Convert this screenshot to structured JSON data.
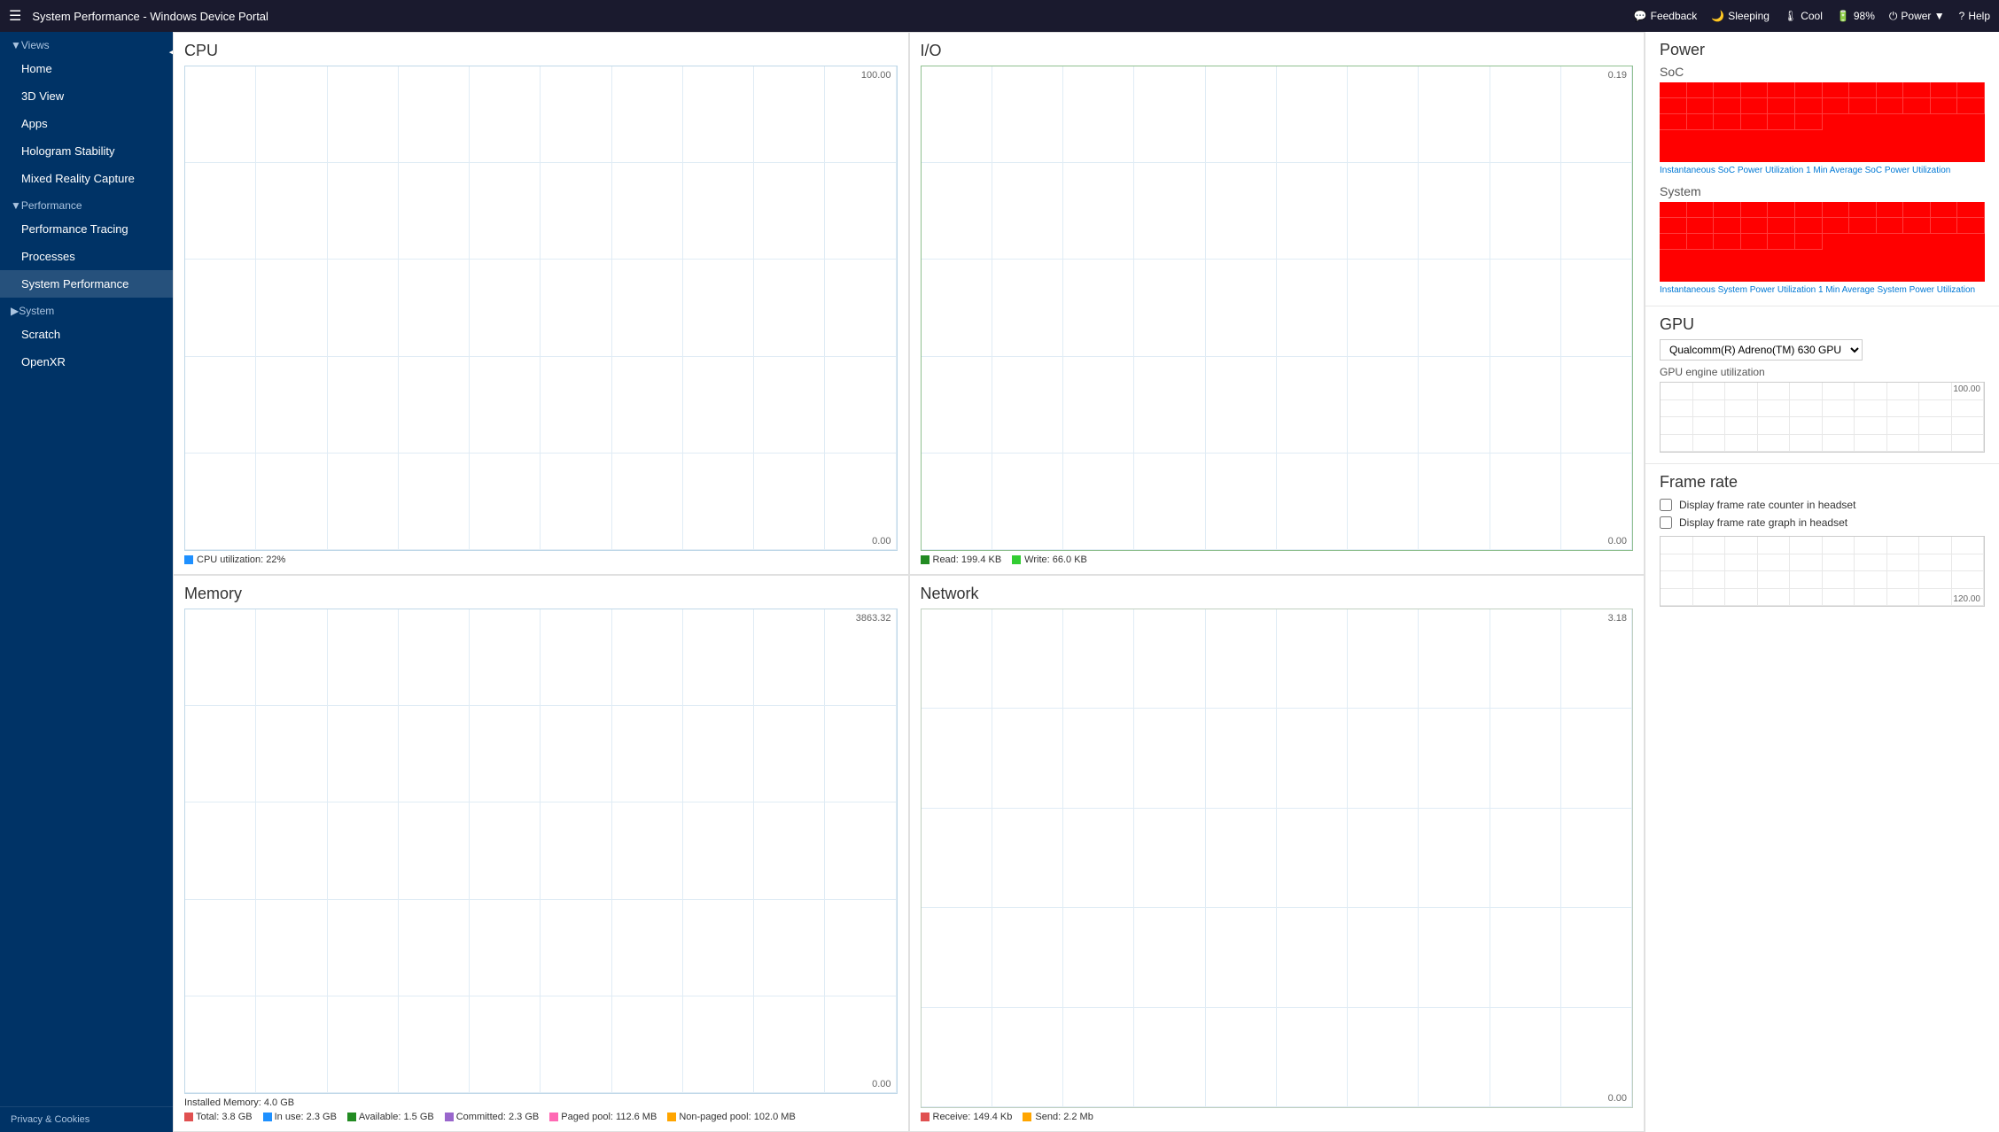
{
  "titleBar": {
    "menuIcon": "☰",
    "title": "System Performance - Windows Device Portal",
    "toolbar": [
      {
        "id": "feedback",
        "icon": "💬",
        "label": "Feedback"
      },
      {
        "id": "sleeping",
        "icon": "🌙",
        "label": "Sleeping"
      },
      {
        "id": "cool",
        "icon": "🌡",
        "label": "Cool"
      },
      {
        "id": "battery",
        "icon": "🔋",
        "label": "98%"
      },
      {
        "id": "power",
        "icon": "⏻",
        "label": "Power ▼"
      },
      {
        "id": "help",
        "icon": "?",
        "label": "Help"
      }
    ]
  },
  "sidebar": {
    "toggleIcon": "◀",
    "sections": [
      {
        "id": "views",
        "header": "▼Views",
        "items": [
          {
            "id": "home",
            "label": "Home"
          },
          {
            "id": "3dview",
            "label": "3D View"
          },
          {
            "id": "apps",
            "label": "Apps"
          },
          {
            "id": "hologram-stability",
            "label": "Hologram Stability"
          },
          {
            "id": "mixed-reality-capture",
            "label": "Mixed Reality Capture"
          }
        ]
      },
      {
        "id": "performance",
        "header": "▼Performance",
        "items": [
          {
            "id": "performance-tracing",
            "label": "Performance Tracing"
          },
          {
            "id": "processes",
            "label": "Processes"
          },
          {
            "id": "system-performance",
            "label": "System Performance",
            "active": true
          }
        ]
      },
      {
        "id": "system",
        "header": "▶System",
        "items": [
          {
            "id": "scratch",
            "label": "Scratch"
          },
          {
            "id": "openxr",
            "label": "OpenXR"
          }
        ]
      }
    ],
    "footer": "Privacy & Cookies"
  },
  "cpu": {
    "title": "CPU",
    "topValue": "100.00",
    "bottomValue": "0.00",
    "legend": [
      {
        "color": "#1e90ff",
        "label": "CPU utilization: 22%"
      }
    ]
  },
  "io": {
    "title": "I/O",
    "topValue": "0.19",
    "bottomValue": "0.00",
    "legend": [
      {
        "color": "#228B22",
        "label": "Read: 199.4 KB"
      },
      {
        "color": "#32CD32",
        "label": "Write: 66.0 KB"
      }
    ]
  },
  "memory": {
    "title": "Memory",
    "topValue": "3863.32",
    "bottomValue": "0.00",
    "installed": "Installed Memory: 4.0 GB",
    "legend": [
      {
        "color": "#e05050",
        "label": "Total: 3.8 GB"
      },
      {
        "color": "#1e90ff",
        "label": "In use: 2.3 GB"
      },
      {
        "color": "#228B22",
        "label": "Available: 1.5 GB"
      },
      {
        "color": "#9966cc",
        "label": "Committed: 2.3 GB"
      },
      {
        "color": "#ff69b4",
        "label": "Paged pool: 112.6 MB"
      },
      {
        "color": "#ffa500",
        "label": "Non-paged pool: 102.0 MB"
      }
    ]
  },
  "network": {
    "title": "Network",
    "topValue": "3.18",
    "bottomValue": "0.00",
    "legend": [
      {
        "color": "#e05050",
        "label": "Receive: 149.4 Kb"
      },
      {
        "color": "#ffa500",
        "label": "Send: 2.2 Mb"
      }
    ]
  },
  "power": {
    "title": "Power",
    "soc": {
      "label": "SoC",
      "instantLabel": "Instantaneous SoC Power Utilization",
      "avgLabel": "1 Min Average SoC Power Utilization"
    },
    "system": {
      "label": "System",
      "instantLabel": "Instantaneous System Power Utilization",
      "avgLabel": "1 Min Average System Power Utilization"
    }
  },
  "gpu": {
    "title": "GPU",
    "selectOptions": [
      "Qualcomm(R) Adreno(TM) 630 GPU"
    ],
    "selectedOption": "Qualcomm(R) Adreno(TM) 630 GPU",
    "engineLabel": "GPU engine utilization",
    "topValue": "100.00"
  },
  "frameRate": {
    "title": "Frame rate",
    "options": [
      {
        "id": "counter",
        "label": "Display frame rate counter in headset"
      },
      {
        "id": "graph",
        "label": "Display frame rate graph in headset"
      }
    ],
    "bottomValue": "120.00"
  }
}
